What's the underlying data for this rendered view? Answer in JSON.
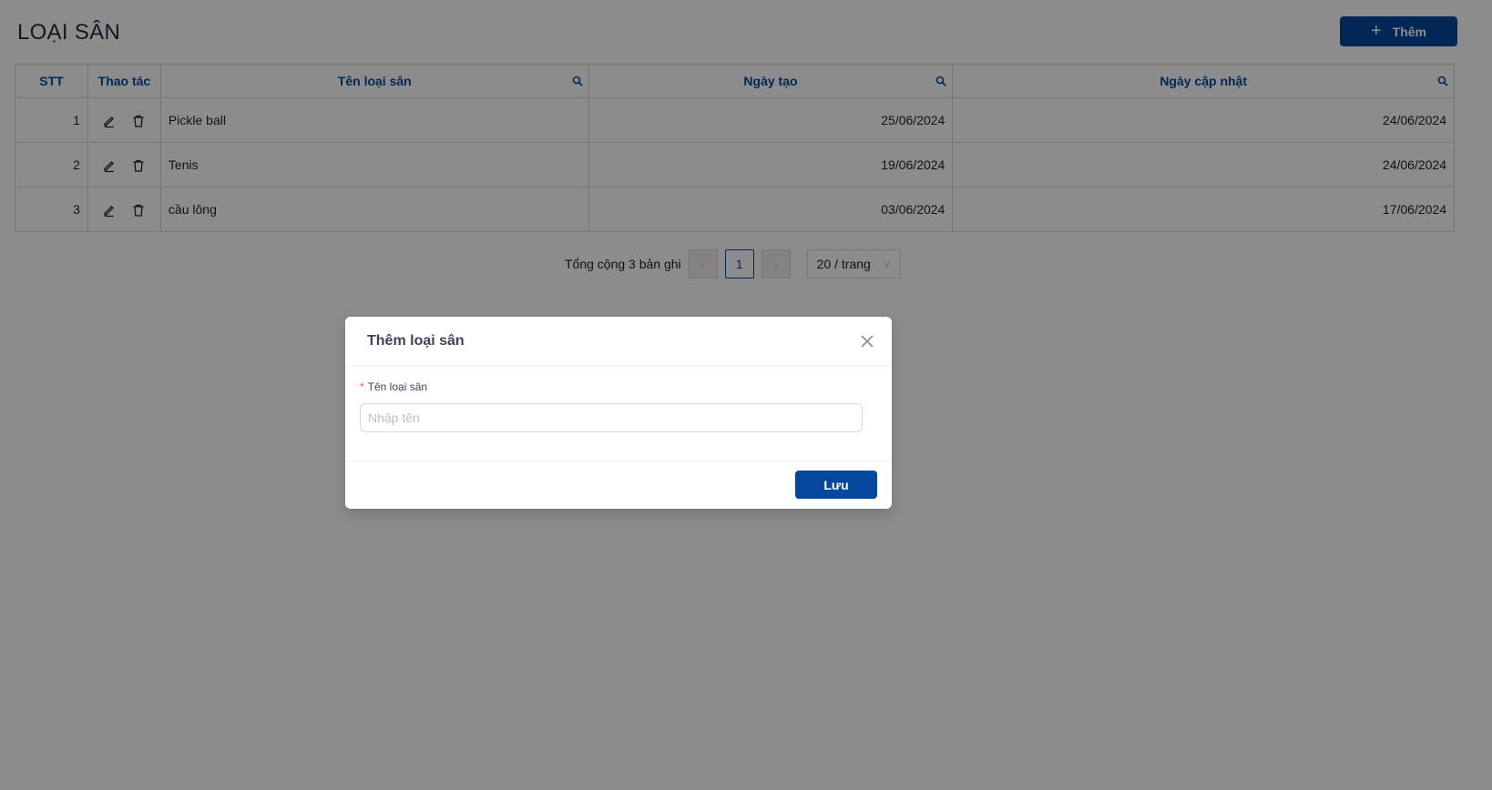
{
  "page": {
    "title": "LOẠI SÂN",
    "add_button_label": "Thêm",
    "add_button_icon": "plus-icon"
  },
  "table": {
    "columns": [
      "STT",
      "Thao tác",
      "Tên loại sân",
      "Ngày tạo",
      "Ngày cập nhật"
    ],
    "rows": [
      {
        "stt": "1",
        "name": "Pickle ball",
        "created": "25/06/2024",
        "updated": "24/06/2024"
      },
      {
        "stt": "2",
        "name": "Tenis",
        "created": "19/06/2024",
        "updated": "24/06/2024"
      },
      {
        "stt": "3",
        "name": "cầu lông",
        "created": "03/06/2024",
        "updated": "17/06/2024"
      }
    ]
  },
  "pagination": {
    "total_text": "Tổng cộng 3 bản ghi",
    "prev_icon": "chevron-left-icon",
    "current_page": "1",
    "next_icon": "chevron-right-icon",
    "page_size": "20 / trang"
  },
  "modal": {
    "title": "Thêm loại sân",
    "field_label": "Tên loại sân",
    "field_required_mark": "*",
    "field_value": "",
    "field_placeholder": "Nhập tên",
    "save_label": "Lưu"
  },
  "colors": {
    "primary": "#04489d",
    "required": "#ff4d4f",
    "overlay": "rgba(0,0,0,0.45)"
  }
}
